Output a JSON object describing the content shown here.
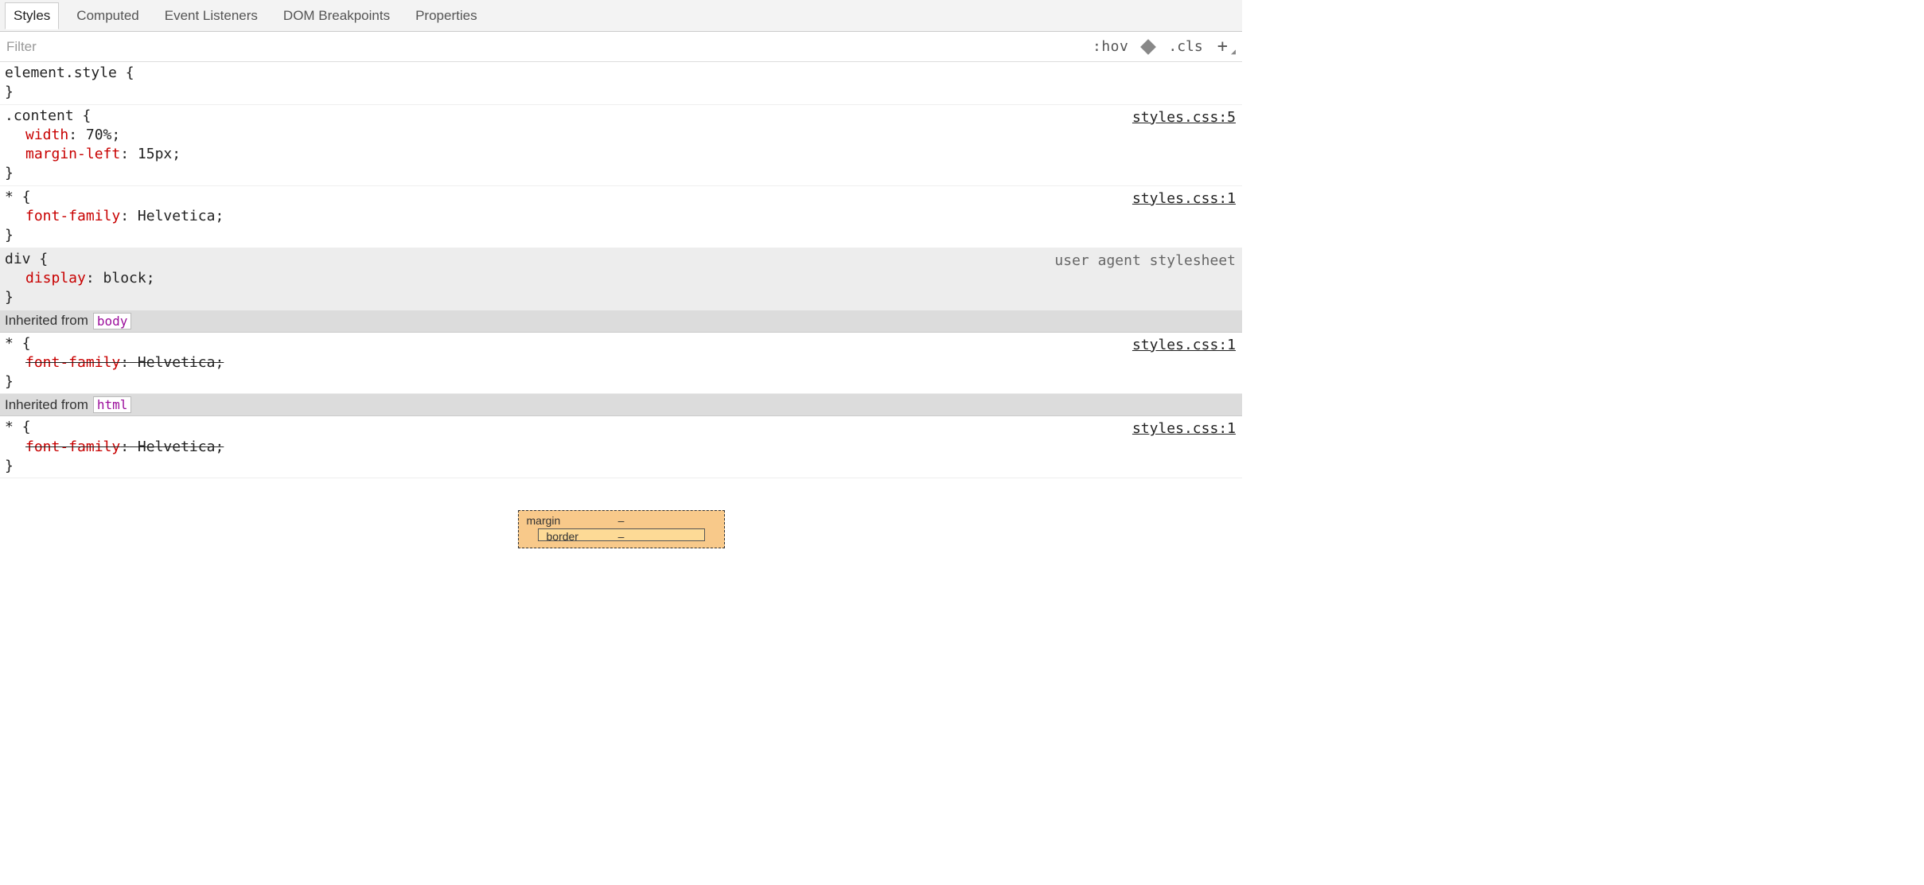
{
  "tabs": {
    "styles": "Styles",
    "computed": "Computed",
    "event_listeners": "Event Listeners",
    "dom_breakpoints": "DOM Breakpoints",
    "properties": "Properties"
  },
  "toolbar": {
    "filter_placeholder": "Filter",
    "hov": ":hov",
    "cls": ".cls",
    "plus": "+"
  },
  "rules": [
    {
      "selector": "element.style",
      "source": "",
      "source_link": false,
      "ua": false,
      "declarations": []
    },
    {
      "selector": ".content",
      "source": "styles.css:5",
      "source_link": true,
      "ua": false,
      "declarations": [
        {
          "prop": "width",
          "val": "70%",
          "struck": false
        },
        {
          "prop": "margin-left",
          "val": "15px",
          "struck": false
        }
      ]
    },
    {
      "selector": "*",
      "source": "styles.css:1",
      "source_link": true,
      "ua": false,
      "declarations": [
        {
          "prop": "font-family",
          "val": "Helvetica",
          "struck": false
        }
      ]
    },
    {
      "selector": "div",
      "source": "user agent stylesheet",
      "source_link": false,
      "ua": true,
      "declarations": [
        {
          "prop": "display",
          "val": "block",
          "struck": false
        }
      ]
    }
  ],
  "inherited": [
    {
      "from_label": "Inherited from",
      "node": "body",
      "rules": [
        {
          "selector": "*",
          "source": "styles.css:1",
          "source_link": true,
          "ua": false,
          "declarations": [
            {
              "prop": "font-family",
              "val": "Helvetica",
              "struck": true
            }
          ]
        }
      ]
    },
    {
      "from_label": "Inherited from",
      "node": "html",
      "rules": [
        {
          "selector": "*",
          "source": "styles.css:1",
          "source_link": true,
          "ua": false,
          "declarations": [
            {
              "prop": "font-family",
              "val": "Helvetica",
              "struck": true
            }
          ]
        }
      ]
    }
  ],
  "box_model": {
    "margin_label": "margin",
    "margin_top": "–",
    "border_label": "border",
    "border_top": "–"
  }
}
